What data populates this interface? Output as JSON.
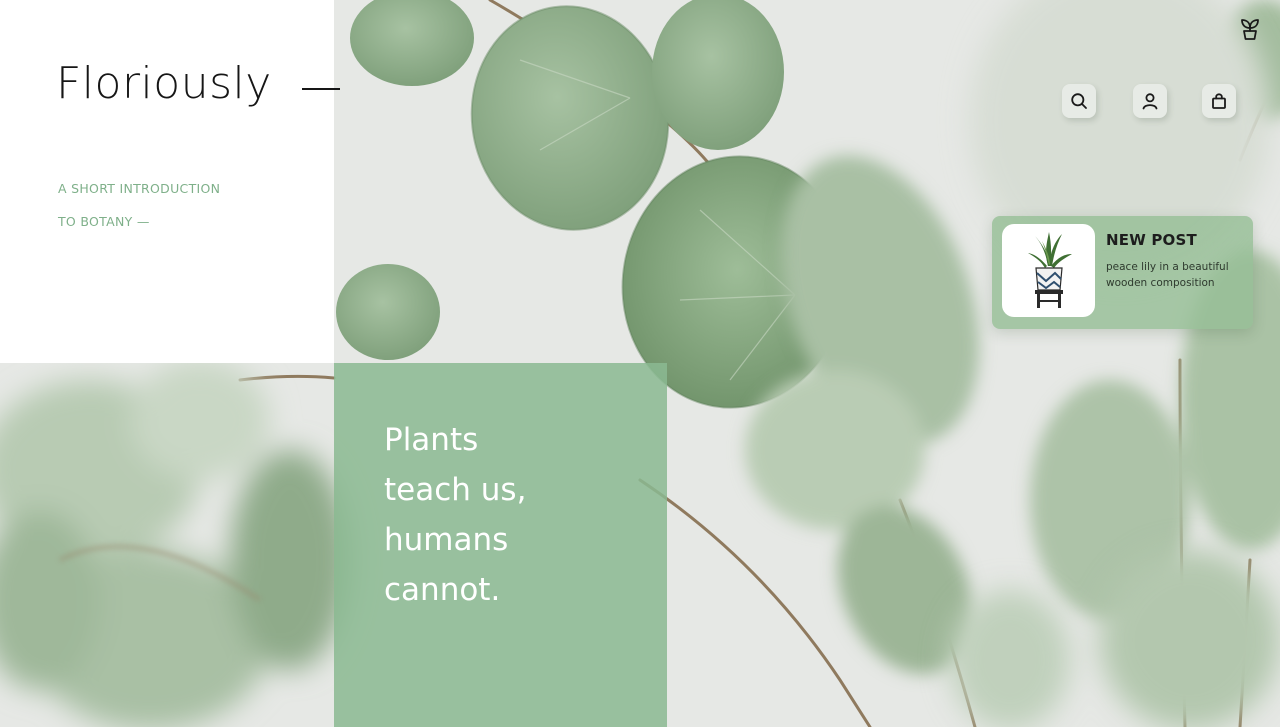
{
  "brand": {
    "name": "Floriously"
  },
  "intro": {
    "line1": "A SHORT INTRODUCTION",
    "line2": "TO BOTANY —"
  },
  "quote": {
    "lines": [
      "Plants",
      "teach us,",
      "humans",
      "cannot."
    ]
  },
  "nav": {
    "icons": [
      "search-icon",
      "user-icon",
      "bag-icon"
    ],
    "logo_icon": "sprout-icon"
  },
  "new_post": {
    "title": "NEW POST",
    "description_line1": "peace lily in a beautiful",
    "description_line2": "wooden composition"
  },
  "colors": {
    "accent_green": "#7fb08a",
    "panel_green": "#8ab991",
    "text_dark": "#161616"
  }
}
